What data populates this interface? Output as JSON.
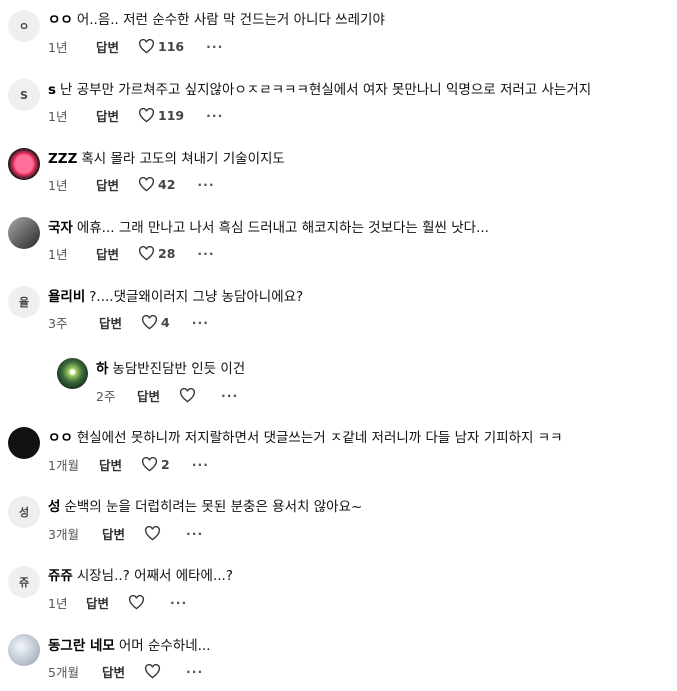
{
  "labels": {
    "reply": "답변",
    "more": "···"
  },
  "comments": [
    {
      "avatar_text": "ㅇ",
      "author": "ㅇㅇ",
      "text": "어..음.. 저런 순수한 사람 막 건드는거 아니다 쓰레기야",
      "time": "1년",
      "likes": "116"
    },
    {
      "avatar_text": "S",
      "author": "s",
      "text": "난 공부만 가르쳐주고 싶지않아ㅇㅈㄹㅋㅋㅋ현실에서 여자 못만나니 익명으로 저러고 사는거지",
      "time": "1년",
      "likes": "119"
    },
    {
      "avatar_text": "",
      "author": "ZZZ",
      "text": "혹시 몰라 고도의 쳐내기 기술이지도",
      "time": "1년",
      "likes": "42"
    },
    {
      "avatar_text": "",
      "author": "국자",
      "text": "에휴... 그래 만나고 나서 흑심 드러내고 해코지하는 것보다는 훨씬 낫다...",
      "time": "1년",
      "likes": "28"
    },
    {
      "avatar_text": "율",
      "author": "욜리비",
      "text": "?....댓글왜이러지 그냥 농담아니에요?",
      "time": "3주",
      "likes": "4"
    },
    {
      "avatar_text": "",
      "author": "하",
      "text": "농담반진담반 인듯 이건",
      "time": "2주",
      "likes": ""
    },
    {
      "avatar_text": "",
      "author": "ㅇㅇ",
      "text": "현실에선 못하니까 저지랄하면서 댓글쓰는거 ㅈ같네 저러니까 다들 남자 기피하지 ㅋㅋ",
      "time": "1개월",
      "likes": "2"
    },
    {
      "avatar_text": "성",
      "author": "성",
      "text": "순백의 눈을 더럽히려는 못된 분충은 용서치 않아요~",
      "time": "3개월",
      "likes": ""
    },
    {
      "avatar_text": "쥬",
      "author": "쥬쥬",
      "text": "시장님..? 어째서 에타에...?",
      "time": "1년",
      "likes": ""
    },
    {
      "avatar_text": "",
      "author": "동그란 네모",
      "text": "어머 순수하네...",
      "time": "5개월",
      "likes": ""
    }
  ]
}
